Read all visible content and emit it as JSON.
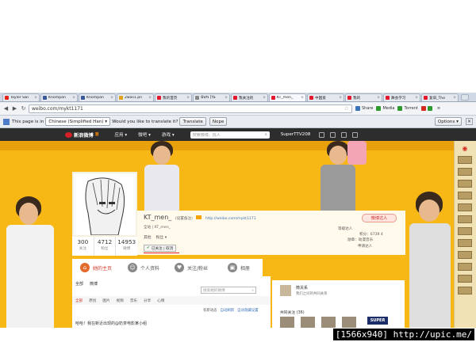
{
  "browser": {
    "tabs": [
      {
        "label": "Taylor Swi",
        "color": "#e62117"
      },
      {
        "label": "Knompan",
        "color": "#3b5998"
      },
      {
        "label": "Knompan",
        "color": "#3b5998"
      },
      {
        "label": "2was1.pn",
        "color": "#e3a21a"
      },
      {
        "label": "我的首页",
        "color": "#e6162d"
      },
      {
        "label": "ฉันรเ [Ya",
        "color": "#888888"
      },
      {
        "label": "我关注的",
        "color": "#e6162d"
      },
      {
        "label": "KT_men_",
        "color": "#e6162d"
      },
      {
        "label": "中国爱",
        "color": "#e6162d"
      },
      {
        "label": "我的",
        "color": "#e6162d"
      },
      {
        "label": "舞会学习",
        "color": "#e6162d"
      },
      {
        "label": "复旧_The",
        "color": "#e6162d"
      }
    ],
    "close_glyph": "×",
    "address": "weibo.com/mykt1171",
    "extensions": [
      {
        "label": "Share",
        "color": "#3a73b8"
      },
      {
        "label": "Media",
        "color": "#2e9a2e"
      },
      {
        "label": "Torrent",
        "color": "#2e9a2e"
      }
    ]
  },
  "translate_bar": {
    "prefix": "This page is in",
    "language": "Chinese (Simplified Han)",
    "question": "Would you like to translate it?",
    "translate_button": "Translate",
    "nope_button": "Nope",
    "options_button": "Options",
    "close": "×"
  },
  "weibo_nav": {
    "logo": "新浪微博",
    "beta": "测",
    "items": [
      "应用 ▾",
      "微吧 ▾",
      "游戏 ▾"
    ],
    "search_placeholder": "搜索微博，找人",
    "username": "SuperTTV208"
  },
  "profile": {
    "name": "KT_men_",
    "note": "(设置备注)",
    "url": "http://weibo.com/mykt1171",
    "desc": "全站 | KT_men_",
    "tags": [
      "其他",
      "粉丝 ▾"
    ],
    "follow_label": "已关注 | 取消",
    "stats": [
      {
        "value": "300",
        "label": "关注"
      },
      {
        "value": "4712",
        "label": "粉丝"
      },
      {
        "value": "14953",
        "label": "微博"
      }
    ],
    "invite_button": "微博达人",
    "right_info": [
      "等级达人",
      "积分：6739 4",
      "勋章：动漫音乐",
      "申请达人"
    ]
  },
  "profile_tabs": [
    {
      "label": "她的主页",
      "color": "#e46a2c"
    },
    {
      "label": "个人资料",
      "color": "#888888"
    },
    {
      "label": "关注/粉丝",
      "color": "#888888"
    },
    {
      "label": "相册",
      "color": "#888888"
    }
  ],
  "feed": {
    "tabs": [
      "全部",
      "微博"
    ],
    "search_placeholder": "搜索她的微博",
    "subtabs": [
      "全部",
      "原创",
      "图片",
      "视频",
      "音乐",
      "分享",
      "心情"
    ],
    "line": [
      "有新动态",
      "自动刷新",
      "自动隐藏设置"
    ],
    "first_post": "哈哈！我在新近出现的@奶茶电影某小组"
  },
  "right_panel": {
    "name": "微关系",
    "sub": "我们之间的共同关系",
    "common": "共同关注 (36)",
    "badge": "SUPER"
  },
  "watermark": "[1566x940] http://upic.me/"
}
